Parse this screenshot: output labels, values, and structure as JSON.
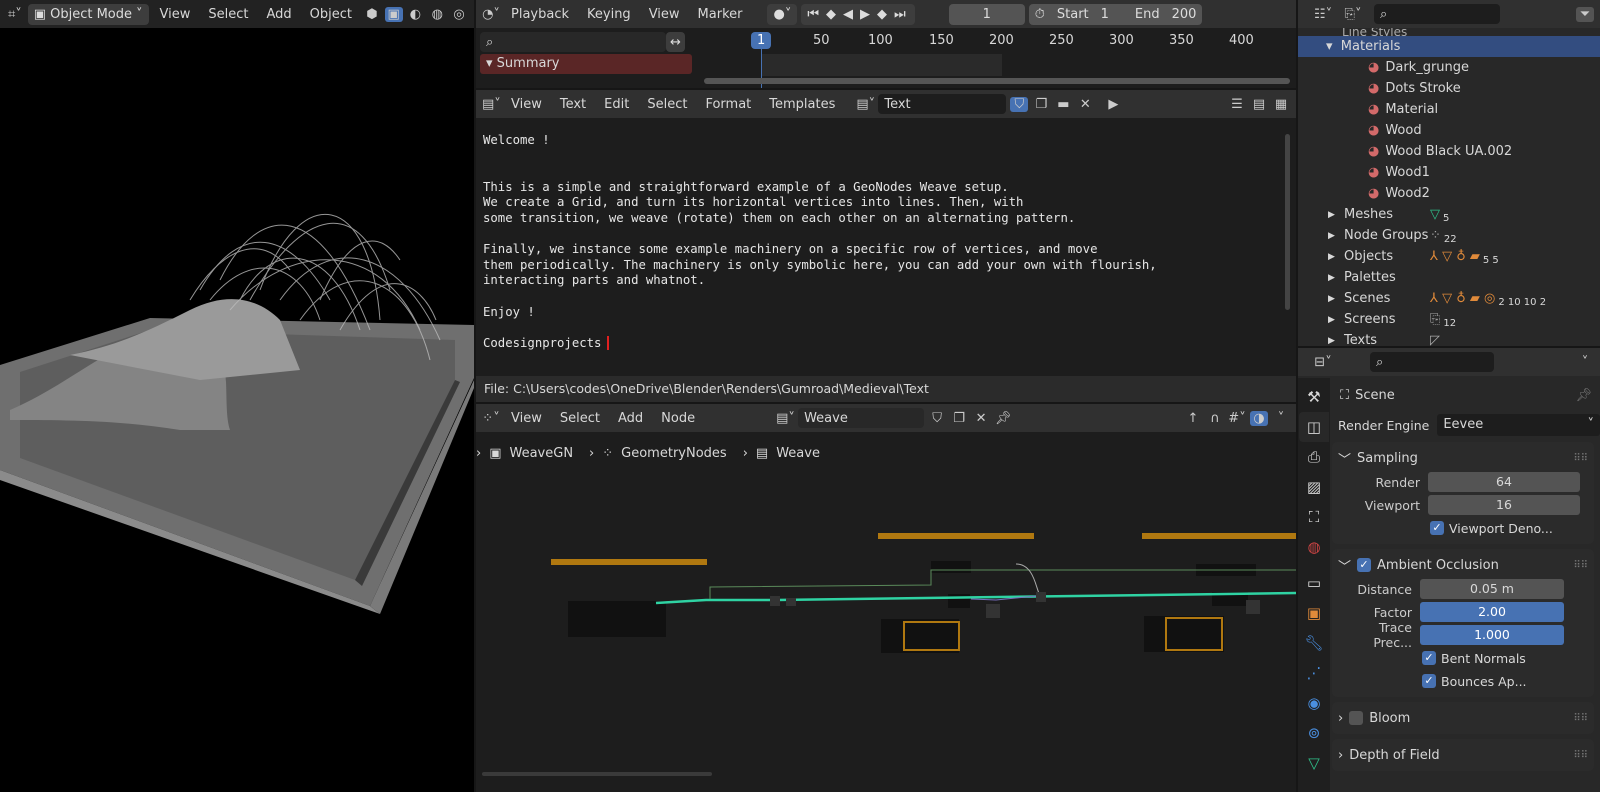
{
  "viewport": {
    "mode": "Object Mode",
    "menu": [
      "View",
      "Select",
      "Add",
      "Object"
    ]
  },
  "timeline": {
    "menu": [
      "Playback",
      "Keying",
      "View",
      "Marker"
    ],
    "current_frame": "1",
    "start_label": "Start",
    "start": "1",
    "end_label": "End",
    "end": "200",
    "ruler": [
      "1",
      "50",
      "100",
      "150",
      "200",
      "250",
      "300",
      "350",
      "400"
    ],
    "summary": "Summary"
  },
  "text_editor": {
    "menu": [
      "View",
      "Text",
      "Edit",
      "Select",
      "Format",
      "Templates"
    ],
    "text_name": "Text",
    "lines": [
      "Welcome !",
      "",
      "",
      "This is a simple and straightforward example of a GeoNodes Weave setup.",
      "We create a Grid, and turn its horizontal vertices into lines. Then, with",
      "some transition, we weave (rotate) them on each other on an alternating pattern.",
      "",
      "Finally, we instance some example machinery on a specific row of vertices, and move",
      "them periodically. The machinery is only symbolic here, you can add your own with flourish,",
      "interacting parts and whatnot.",
      "",
      "Enjoy !",
      "",
      "Codesignprojects"
    ],
    "file_path": "File: C:\\Users\\codes\\OneDrive\\Blender\\Renders\\Gumroad\\Medieval\\Text"
  },
  "node_editor": {
    "menu": [
      "View",
      "Select",
      "Add",
      "Node"
    ],
    "node_tree": "Weave",
    "breadcrumb": [
      "WeaveGN",
      "GeometryNodes",
      "Weave"
    ]
  },
  "outliner": {
    "partial_top": "Line Styles",
    "materials_label": "Materials",
    "materials": [
      "Dark_grunge",
      "Dots Stroke",
      "Material",
      "Wood",
      "Wood Black UA.002",
      "Wood1",
      "Wood2"
    ],
    "categories": [
      {
        "label": "Meshes",
        "badge": "5"
      },
      {
        "label": "Node Groups",
        "badge": "22"
      },
      {
        "label": "Objects",
        "badge": "5  5"
      },
      {
        "label": "Palettes",
        "badge": ""
      },
      {
        "label": "Scenes",
        "badge": "2  10  10  2"
      },
      {
        "label": "Screens",
        "badge": "12"
      },
      {
        "label": "Texts",
        "badge": ""
      }
    ]
  },
  "properties": {
    "context": "Scene",
    "render_engine_label": "Render Engine",
    "render_engine": "Eevee",
    "sampling": {
      "title": "Sampling",
      "render_label": "Render",
      "render": "64",
      "viewport_label": "Viewport",
      "viewport": "16",
      "denoise": "Viewport Deno..."
    },
    "ao": {
      "title": "Ambient Occlusion",
      "distance_label": "Distance",
      "distance": "0.05 m",
      "factor_label": "Factor",
      "factor": "2.00",
      "trace_label": "Trace Prec...",
      "trace": "1.000",
      "bent": "Bent Normals",
      "bounces": "Bounces Ap..."
    },
    "bloom": "Bloom",
    "dof": "Depth of Field"
  },
  "colors": {
    "accent": "#4772b3",
    "summary": "#5a2626",
    "frame": "#b07810",
    "wire": "#2fd3a3"
  }
}
